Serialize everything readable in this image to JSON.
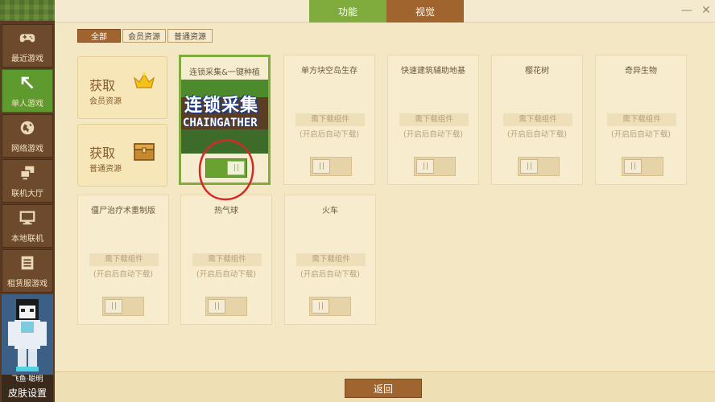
{
  "sidebar": {
    "items": [
      {
        "label": "最近游戏",
        "icon": "gamepad-icon"
      },
      {
        "label": "单人游戏",
        "icon": "cursor-arrow-icon",
        "active": true
      },
      {
        "label": "网络游戏",
        "icon": "globe-icon"
      },
      {
        "label": "联机大厅",
        "icon": "multi-screen-icon"
      },
      {
        "label": "本地联机",
        "icon": "monitor-icon"
      },
      {
        "label": "租赁服游戏",
        "icon": "list-icon"
      }
    ],
    "avatar_name": "飞鱼·聪明",
    "skin_button": "皮肤设置"
  },
  "top_tabs": [
    {
      "label": "功能",
      "active": true
    },
    {
      "label": "视觉",
      "active": false
    }
  ],
  "window_controls": {
    "minimize": "—",
    "close": "✕"
  },
  "filter_tabs": [
    {
      "label": "全部",
      "active": true
    },
    {
      "label": "会员资源",
      "active": false
    },
    {
      "label": "普通资源",
      "active": false
    }
  ],
  "resources": [
    {
      "title": "获取",
      "subtitle": "会员资源",
      "icon": "crown-icon"
    },
    {
      "title": "获取",
      "subtitle": "普通资源",
      "icon": "chest-icon"
    }
  ],
  "featured_mod": {
    "title": "连锁采集&一键种植",
    "image_text_1": "连锁采集",
    "image_text_2": "CHAINGATHER",
    "toggle_on": true
  },
  "mods": [
    {
      "title": "单方块空岛生存",
      "download": "需下载组件",
      "auto": "(开启后自动下载)"
    },
    {
      "title": "快速建筑辅助地基",
      "download": "需下载组件",
      "auto": "(开启后自动下载)"
    },
    {
      "title": "樱花树",
      "download": "需下载组件",
      "auto": "(开启后自动下载)"
    },
    {
      "title": "奇异生物",
      "download": "需下载组件",
      "auto": "(开启后自动下载)"
    },
    {
      "title": "僵尸治疗术重制版",
      "download": "需下载组件",
      "auto": "(开启后自动下载)"
    },
    {
      "title": "热气球",
      "download": "需下载组件",
      "auto": "(开启后自动下载)"
    },
    {
      "title": "火车",
      "download": "需下载组件",
      "auto": "(开启后自动下载)"
    }
  ],
  "toggle_knob": "| |",
  "back_button": "返回",
  "colors": {
    "accent_green": "#7fac3c",
    "brown": "#a0642f",
    "annotation_red": "#d42a2a"
  }
}
